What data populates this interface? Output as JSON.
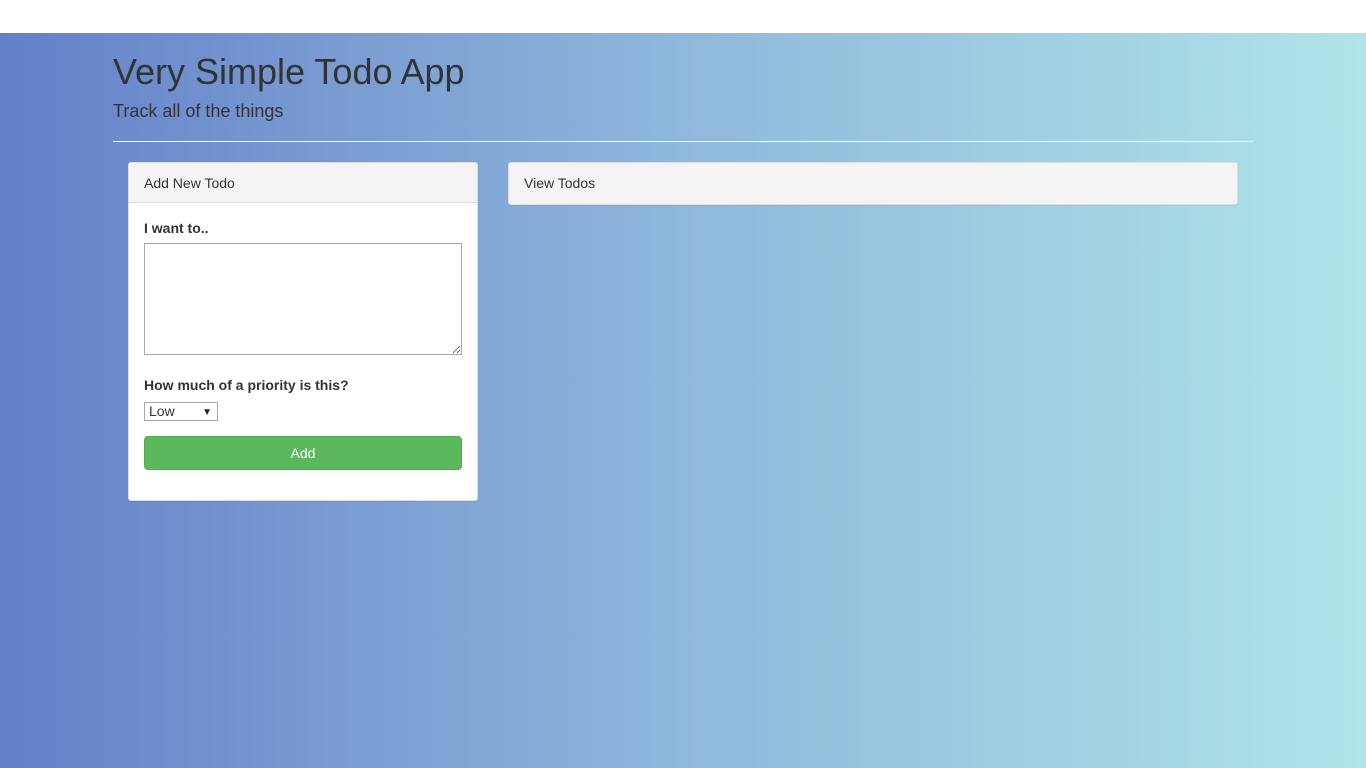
{
  "header": {
    "title": "Very Simple Todo App",
    "subtitle": "Track all of the things"
  },
  "add_panel": {
    "heading": "Add New Todo",
    "todo_label": "I want to..",
    "todo_value": "",
    "priority_label": "How much of a priority is this?",
    "priority_selected": "Low",
    "add_label": "Add"
  },
  "view_panel": {
    "heading": "View Todos"
  },
  "colors": {
    "gradient_start": "#6480c8",
    "gradient_end": "#b0e4e8",
    "add_button": "#5cb85c"
  }
}
